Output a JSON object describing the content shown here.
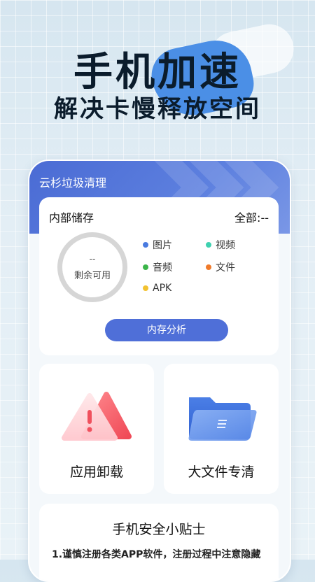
{
  "hero": {
    "title": "手机加速",
    "subtitle": "解决卡慢释放空间"
  },
  "app": {
    "name": "云杉垃圾清理"
  },
  "storage": {
    "title": "内部储存",
    "total": "全部:--",
    "remaining_value": "--",
    "remaining_label": "剩余可用",
    "legend": [
      {
        "label": "图片",
        "color": "#4a7be0"
      },
      {
        "label": "视频",
        "color": "#3fd1b0"
      },
      {
        "label": "音频",
        "color": "#3bb54a"
      },
      {
        "label": "文件",
        "color": "#f07a2a"
      },
      {
        "label": "APK",
        "color": "#f2c230"
      }
    ],
    "button": "内存分析"
  },
  "tiles": [
    {
      "label": "应用卸载",
      "icon": "warning-triangle-icon"
    },
    {
      "label": "大文件专清",
      "icon": "folder-icon"
    }
  ],
  "tips": {
    "title": "手机安全小贴士",
    "text": "1.谨慎注册各类APP软件，注册过程中注意隐藏"
  }
}
